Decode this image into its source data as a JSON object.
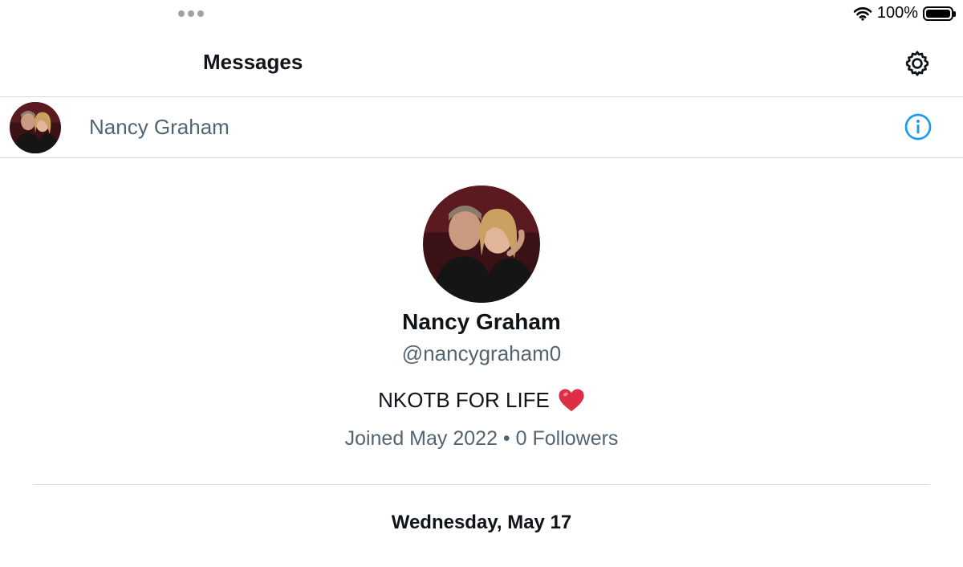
{
  "status_bar": {
    "battery_percent": "100%",
    "icons": [
      "multitasking-dots-icon",
      "wifi-icon",
      "battery-icon"
    ]
  },
  "header": {
    "title": "Messages",
    "settings_icon": "gear-icon"
  },
  "conversation": {
    "name": "Nancy Graham",
    "info_icon": "info-icon",
    "accent_color": "#1d9bf0"
  },
  "profile": {
    "name": "Nancy Graham",
    "handle": "@nancygraham0",
    "bio": "NKOTB FOR LIFE",
    "bio_emoji": "heart-emoji-icon",
    "meta": "Joined May 2022 • 0 Followers"
  },
  "timeline": {
    "date_separator": "Wednesday, May 17"
  }
}
